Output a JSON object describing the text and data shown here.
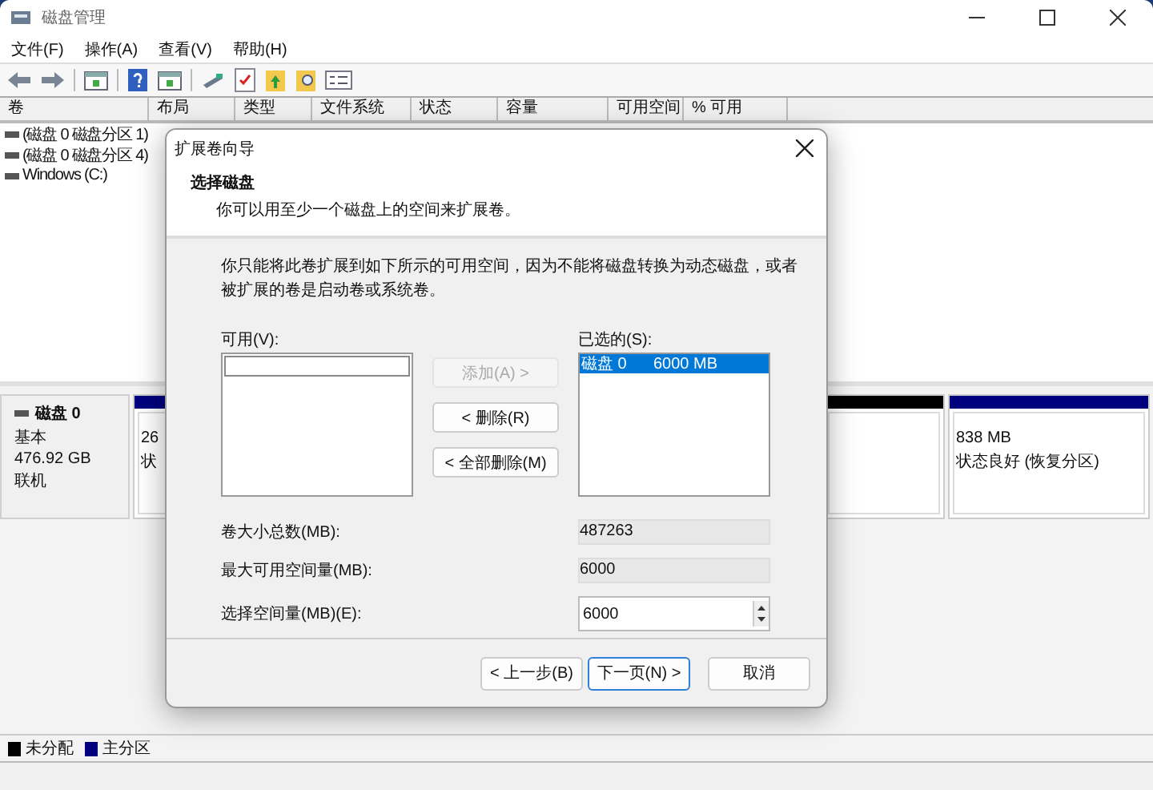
{
  "window": {
    "title": "磁盘管理"
  },
  "menu": [
    {
      "label": "文件(F)"
    },
    {
      "label": "操作(A)"
    },
    {
      "label": "查看(V)"
    },
    {
      "label": "帮助(H)"
    }
  ],
  "table": {
    "columns": [
      "卷",
      "布局",
      "类型",
      "文件系统",
      "状态",
      "容量",
      "可用空间",
      "% 可用"
    ],
    "rows": [
      {
        "volume": "(磁盘 0 磁盘分区 1)"
      },
      {
        "volume": "(磁盘 0 磁盘分区 4)"
      },
      {
        "volume": "Windows (C:)"
      }
    ]
  },
  "disks": [
    {
      "name": "磁盘 0",
      "type": "基本",
      "size": "476.92 GB",
      "status": "联机",
      "partitions": [
        {
          "kind": "primary",
          "lines": [
            "26",
            "状"
          ]
        },
        {
          "kind": "unallocated"
        },
        {
          "kind": "primary",
          "lines": [
            "838 MB",
            "状态良好 (恢复分区)"
          ]
        }
      ]
    }
  ],
  "legend": [
    {
      "label": "未分配",
      "color": "#000000"
    },
    {
      "label": "主分区",
      "color": "#00007f"
    }
  ],
  "dialog": {
    "title": "扩展卷向导",
    "heading": "选择磁盘",
    "subheading": "你可以用至少一个磁盘上的空间来扩展卷。",
    "note": "你只能将此卷扩展到如下所示的可用空间，因为不能将磁盘转换为动态磁盘，或者被扩展的卷是启动卷或系统卷。",
    "available_label": "可用(V):",
    "selected_label": "已选的(S):",
    "move_buttons": [
      {
        "label": "添加(A) >",
        "disabled": true
      },
      {
        "label": "< 删除(R)",
        "disabled": false
      },
      {
        "label": "< 全部删除(M)",
        "disabled": false
      }
    ],
    "selected_items": [
      {
        "disk": "磁盘 0",
        "size": "6000 MB",
        "selected": true
      }
    ],
    "fields": [
      {
        "kind": "readonly",
        "label": "卷大小总数(MB):",
        "value": "487263"
      },
      {
        "kind": "readonly",
        "label": "最大可用空间量(MB):",
        "value": "6000"
      },
      {
        "kind": "spinner",
        "label": "选择空间量(MB)(E):",
        "value": "6000"
      }
    ],
    "footer_buttons": [
      {
        "label": "< 上一步(B)",
        "default": false
      },
      {
        "label": "下一页(N) >",
        "default": true
      },
      {
        "label": "取消",
        "default": false
      }
    ]
  }
}
